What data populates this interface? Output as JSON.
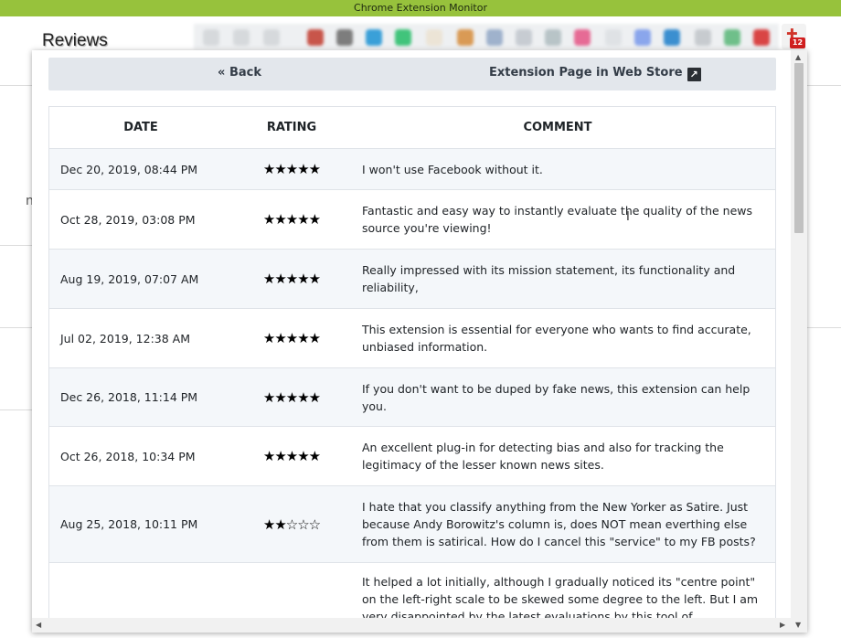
{
  "window": {
    "title": "Chrome Extension Monitor"
  },
  "background": {
    "heading": "Reviews",
    "extension_badge": "12"
  },
  "nav": {
    "back_label": "Back",
    "store_label": "Extension Page in Web Store"
  },
  "table": {
    "headers": {
      "date": "DATE",
      "rating": "RATING",
      "comment": "COMMENT"
    },
    "rows": [
      {
        "date": "Dec 20, 2019, 08:44 PM",
        "rating": 5,
        "stars": "★★★★★",
        "comment": "I won't use Facebook without it."
      },
      {
        "date": "Oct 28, 2019, 03:08 PM",
        "rating": 5,
        "stars": "★★★★★",
        "comment": "Fantastic and easy way to instantly evaluate the quality of the news source you're viewing!"
      },
      {
        "date": "Aug 19, 2019, 07:07 AM",
        "rating": 5,
        "stars": "★★★★★",
        "comment": "Really impressed with its mission statement, its functionality and reliability,"
      },
      {
        "date": "Jul 02, 2019, 12:38 AM",
        "rating": 5,
        "stars": "★★★★★",
        "comment": "This extension is essential for everyone who wants to find accurate, unbiased information."
      },
      {
        "date": "Dec 26, 2018, 11:14 PM",
        "rating": 5,
        "stars": "★★★★★",
        "comment": "If you don't want to be duped by fake news, this extension can help you."
      },
      {
        "date": "Oct 26, 2018, 10:34 PM",
        "rating": 5,
        "stars": "★★★★★",
        "comment": "An excellent plug-in for detecting bias and also for tracking the legitimacy of the lesser known news sites."
      },
      {
        "date": "Aug 25, 2018, 10:11 PM",
        "rating": 2,
        "stars": "★★☆☆☆",
        "comment": "I hate that you classify anything from the New Yorker as Satire. Just because Andy Borowitz's column is, does NOT mean everthing else from them is satirical. How do I cancel this \"service\" to my FB posts?"
      },
      {
        "date": "",
        "rating": null,
        "stars": "",
        "comment": "It helped a lot initially, although I gradually noticed its \"centre point\" on the left-right scale to be skewed some degree to the left. But I am very disappointed by the latest evaluations by this tool of"
      }
    ]
  },
  "colors": {
    "titlebar": "#97c23c",
    "nav_bg": "#e3e7ec",
    "row_alt": "#f4f7fa",
    "badge": "#d11f1f"
  }
}
